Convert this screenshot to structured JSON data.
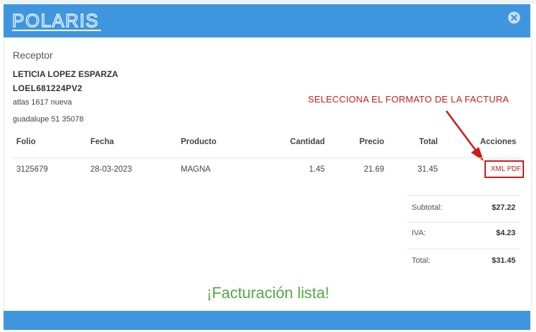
{
  "header": {
    "logo_text": "POLARIS",
    "close_icon": "close-circle-icon",
    "color": "#3f96df"
  },
  "receptor": {
    "title": "Receptor",
    "name": "LETICIA LOPEZ ESPARZA",
    "rfc": "LOEL681224PV2",
    "address_line1": "atlas  1617 nueva",
    "address_line2": "guadalupe 51  35078"
  },
  "annotation": {
    "text": "SELECCIONA EL FORMATO DE LA FACTURA",
    "color": "#d0191b"
  },
  "table": {
    "headers": [
      "Folio",
      "Fecha",
      "Producto",
      "Cantidad",
      "Precio",
      "Total",
      "Acciones"
    ],
    "rows": [
      {
        "folio": "3125679",
        "fecha": "28-03-2023",
        "producto": "MAGNA",
        "cantidad": "1.45",
        "precio": "21.69",
        "total": "31.45",
        "xml": "XML",
        "pdf": "PDF"
      }
    ]
  },
  "totals": {
    "subtotal_label": "Subtotal:",
    "subtotal_value": "$27.22",
    "iva_label": "IVA:",
    "iva_value": "$4.23",
    "total_label": "Total:",
    "total_value": "$31.45"
  },
  "status": {
    "message": "¡Facturación lista!",
    "color": "#53a93f"
  }
}
